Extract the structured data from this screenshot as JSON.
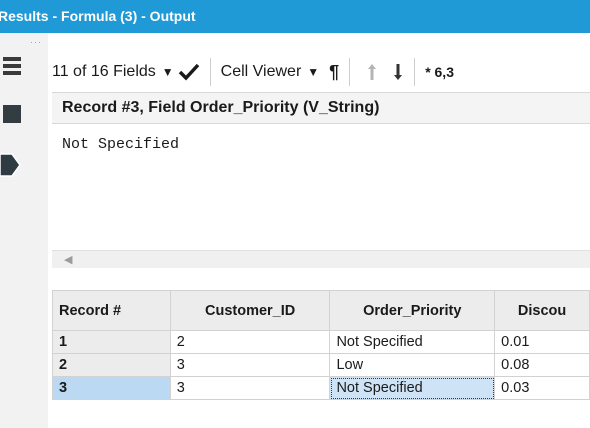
{
  "window": {
    "title": "Results - Formula (3) - Output"
  },
  "toolbar": {
    "fields_label": "11 of 16 Fields",
    "cell_viewer_label": "Cell Viewer",
    "pilcrow": "¶",
    "count_prefix": "* 6,3"
  },
  "record_header": "Record #3, Field Order_Priority (V_String)",
  "cell_value": "Not Specified",
  "table": {
    "columns": [
      "Record #",
      "Customer_ID",
      "Order_Priority",
      "Discou"
    ],
    "rows": [
      {
        "record": "1",
        "customer_id": "2",
        "order_priority": "Not Specified",
        "discount": "0.01"
      },
      {
        "record": "2",
        "customer_id": "3",
        "order_priority": "Low",
        "discount": "0.08"
      },
      {
        "record": "3",
        "customer_id": "3",
        "order_priority": "Not Specified",
        "discount": "0.03"
      }
    ],
    "selected_row": 3
  },
  "icons": {
    "fields_menu": "hamburger-icon",
    "apply": "checkmark-icon",
    "up": "arrow-up-icon",
    "down": "arrow-down-icon"
  },
  "colors": {
    "title_bar": "#1f9ad6",
    "selection": "#bcd9f3"
  }
}
